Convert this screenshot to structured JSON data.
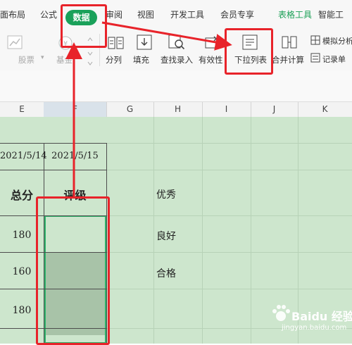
{
  "tabs": [
    "面布局",
    "公式",
    "数据",
    "审阅",
    "视图",
    "开发工具",
    "会员专享",
    "表格工具",
    "智能工"
  ],
  "ribbon": {
    "stock": "股票",
    "fund": "基金",
    "split": "分列",
    "fill": "填充",
    "find": "查找录入",
    "validity": "有效性",
    "dropdown": "下拉列表",
    "merge_calc": "合并计算",
    "simulate": "模拟分析",
    "record": "记录单"
  },
  "columns": [
    "E",
    "F",
    "G",
    "H",
    "I",
    "J",
    "K"
  ],
  "cells": {
    "e_date": "2021/5/14",
    "f_date": "2021/5/15",
    "e_header": "总分",
    "f_header": "评级",
    "h1": "优秀",
    "h2": "良好",
    "h3": "合格",
    "e1": "180",
    "e2": "160",
    "e3": "180"
  },
  "watermark": {
    "brand": "Baidu 经验",
    "url": "jingyan.baidu.com"
  },
  "colors": {
    "accent": "#1aa15a",
    "annotation": "#e8232a",
    "grid_bg": "#cde6cd",
    "selected_fill": "#a8c3a8"
  }
}
